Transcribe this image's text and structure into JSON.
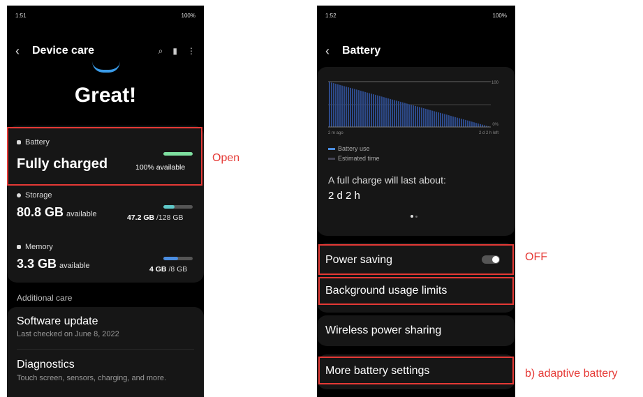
{
  "left_screen": {
    "status": {
      "time": "1:51",
      "right": "100%"
    },
    "title": "Device care",
    "headline": "Great!",
    "battery": {
      "label": "Battery",
      "value": "Fully charged",
      "available": "100% available",
      "level": 1.0
    },
    "storage": {
      "label": "Storage",
      "value": "80.8 GB",
      "value_suffix": "available",
      "used": "47.2 GB",
      "total": "/128 GB",
      "level": 0.37
    },
    "memory": {
      "label": "Memory",
      "value": "3.3 GB",
      "value_suffix": "available",
      "used": "4 GB",
      "total": "/8 GB",
      "level": 0.5
    },
    "additional_care": "Additional care",
    "software_update": {
      "title": "Software update",
      "sub": "Last checked on June 8, 2022"
    },
    "diagnostics": {
      "title": "Diagnostics",
      "sub": "Touch screen, sensors, charging, and more."
    }
  },
  "right_screen": {
    "status": {
      "time": "1:52",
      "right": "100%"
    },
    "title": "Battery",
    "chart": {
      "y_top": "100",
      "y_bottom": "0%",
      "x_left": "2 m ago",
      "x_right": "2 d 2 h left",
      "legend": [
        "Battery use",
        "Estimated time"
      ]
    },
    "full_charge_label": "A full charge will last about:",
    "full_charge_value": "2 d 2 h",
    "power_saving": {
      "label": "Power saving",
      "on": false
    },
    "background_limits": "Background usage limits",
    "wireless_sharing": "Wireless power sharing",
    "more_settings": "More battery settings"
  },
  "annotations": {
    "open": "Open",
    "off": "OFF",
    "adaptive": "b) adaptive battery"
  },
  "colors": {
    "battery_bar": "#7ee0a0",
    "storage_bar": "#5ec8c8",
    "memory_bar": "#4a8de0",
    "highlight": "#e53935"
  }
}
